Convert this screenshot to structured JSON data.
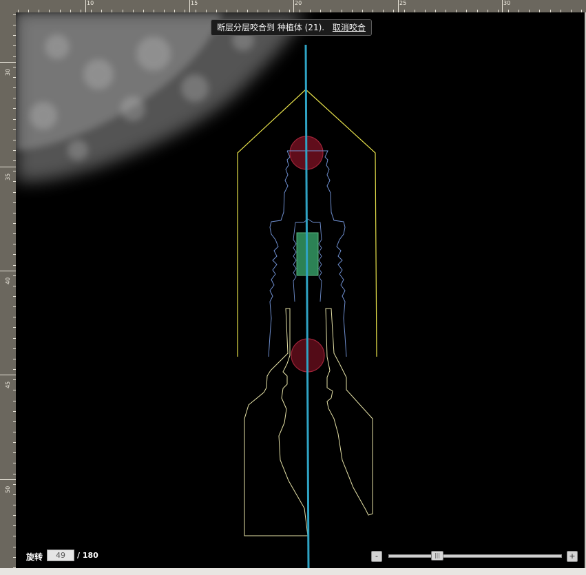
{
  "ruler": {
    "top_labels": [
      "10",
      "15",
      "20",
      "25",
      "30"
    ],
    "left_labels": [
      "30",
      "35",
      "40",
      "45",
      "50"
    ]
  },
  "banner": {
    "text": "断层分层咬合到 种植体 (21).",
    "link": "取消咬合"
  },
  "rotation": {
    "label": "旋转",
    "value": "49",
    "total": "/ 180"
  },
  "zoom": {
    "minus": "-",
    "plus": "+",
    "thumb": "|||",
    "level": 0.28
  },
  "colors": {
    "background": "#000000",
    "axis_line": "#2fa3c4",
    "safety_outline": "#e6e04a",
    "implant_outline": "#6f8fd0",
    "abutment_outline": "#e7e3a8",
    "marker_fill": "#6b0f1e",
    "marker_stroke": "#b0283f",
    "green_block": "#2f8a5a"
  }
}
